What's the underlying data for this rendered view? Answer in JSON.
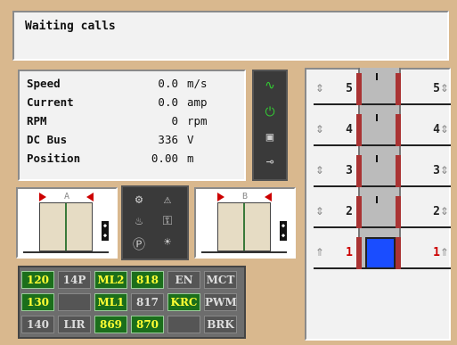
{
  "waiting": {
    "title": "Waiting calls"
  },
  "params": [
    {
      "label": "Speed",
      "value": "0.0",
      "unit": "m/s"
    },
    {
      "label": "Current",
      "value": "0.0",
      "unit": "amp"
    },
    {
      "label": "RPM",
      "value": "0",
      "unit": "rpm"
    },
    {
      "label": "DC Bus",
      "value": "336",
      "unit": "V"
    },
    {
      "label": "Position",
      "value": "0.00",
      "unit": "m"
    }
  ],
  "doors": {
    "a": "A",
    "b": "B"
  },
  "status": {
    "rows": [
      [
        {
          "t": "120",
          "on": true
        },
        {
          "t": "14P",
          "on": false
        },
        {
          "t": "ML2",
          "on": true
        },
        {
          "t": "818",
          "on": true
        },
        {
          "t": "EN",
          "on": false
        },
        {
          "t": "MCT",
          "on": false
        }
      ],
      [
        {
          "t": "130",
          "on": true
        },
        {
          "t": "",
          "on": false
        },
        {
          "t": "ML1",
          "on": true
        },
        {
          "t": "817",
          "on": false
        },
        {
          "t": "KRC",
          "on": true
        },
        {
          "t": "PWM",
          "on": false
        }
      ],
      [
        {
          "t": "140",
          "on": false
        },
        {
          "t": "LIR",
          "on": false
        },
        {
          "t": "869",
          "on": true
        },
        {
          "t": "870",
          "on": true
        },
        {
          "t": "",
          "on": false
        },
        {
          "t": "BRK",
          "on": false
        }
      ]
    ]
  },
  "floors": [
    {
      "n": "5",
      "current": false
    },
    {
      "n": "4",
      "current": false
    },
    {
      "n": "3",
      "current": false
    },
    {
      "n": "2",
      "current": false
    },
    {
      "n": "1",
      "current": true
    }
  ],
  "colors": {
    "accent": "#1b6e1b",
    "led": "#ffff33",
    "cab": "#1a4dff",
    "alarm": "#cc0000"
  }
}
